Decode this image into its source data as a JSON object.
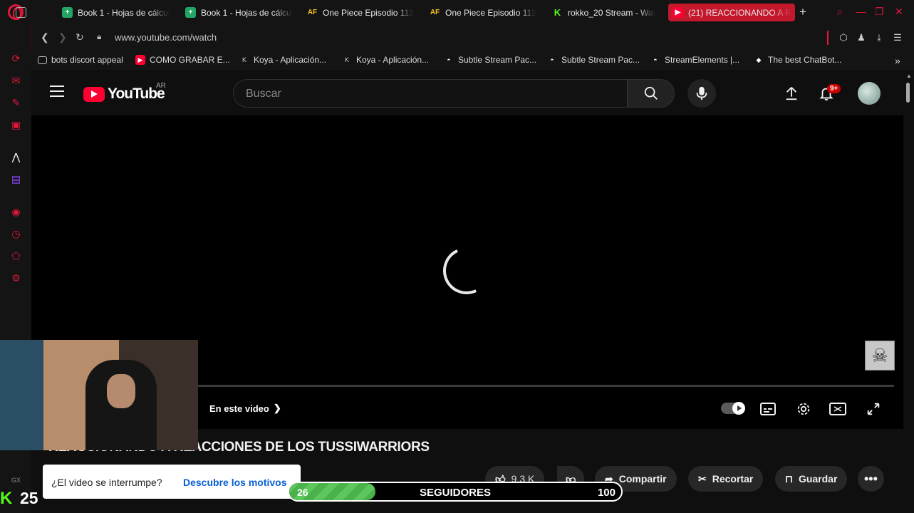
{
  "tabs": [
    {
      "label": "Book 1 - Hojas de cálcul",
      "icon": "sheets-icon",
      "color": "#23a566"
    },
    {
      "label": "Book 1 - Hojas de cálcul",
      "icon": "sheets-icon",
      "color": "#23a566"
    },
    {
      "label": "One Piece Episodio 113",
      "icon": "af-icon",
      "color": "#f0c020"
    },
    {
      "label": "One Piece Episodio 113",
      "icon": "af-icon",
      "color": "#f0c020"
    },
    {
      "label": "rokko_20 Stream - Wat",
      "icon": "kick-icon",
      "color": "#53fc18"
    },
    {
      "label": "(21) REACCIONANDO A R",
      "icon": "youtube-icon",
      "color": "#ff0033",
      "active": true
    }
  ],
  "address": {
    "url": "www.youtube.com/watch"
  },
  "bookmarks": [
    {
      "label": "bots discort appeal",
      "icon": "folder-icon"
    },
    {
      "label": "COMO GRABAR E...",
      "icon": "youtube-icon"
    },
    {
      "label": "Koya - Aplicación...",
      "icon": "koya-icon"
    },
    {
      "label": "Koya - Aplicación...",
      "icon": "koya-icon"
    },
    {
      "label": "Subtle Stream Pac...",
      "icon": "streamelements-icon"
    },
    {
      "label": "Subtle Stream Pac...",
      "icon": "streamelements-icon"
    },
    {
      "label": "StreamElements |...",
      "icon": "streamelements-icon"
    },
    {
      "label": "The best ChatBot...",
      "icon": "chatbot-icon"
    }
  ],
  "youtube": {
    "logo_text": "YouTube",
    "country": "AR",
    "search_placeholder": "Buscar",
    "notifications": "9+"
  },
  "player": {
    "in_this_video": "En este video"
  },
  "video": {
    "title": "REACCIONANDO A REACCIONES DE LOS TUSSIWARRIORS",
    "likes": "9.3 K",
    "share": "Compartir",
    "clip": "Recortar",
    "save": "Guardar"
  },
  "interrupt": {
    "question": "¿El video se interrumpe?",
    "link": "Descubre los motivos"
  },
  "followers": {
    "current": "26",
    "label": "SEGUIDORES",
    "goal": "100",
    "progress": 0.26
  },
  "kick": {
    "viewers": "25"
  }
}
